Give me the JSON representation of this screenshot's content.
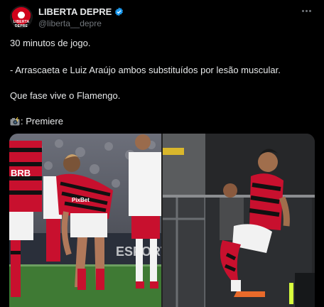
{
  "tweet": {
    "display_name": "LIBERTA DEPRE",
    "handle": "@liberta__depre",
    "avatar_text": "LIBERTA DEPRE",
    "lines": [
      "30 minutos de jogo.",
      "- Arrascaeta e Luiz Araújo ambos substituídos por lesão muscular.",
      "Que fase vive o Flamengo.",
      ": Premiere"
    ]
  },
  "media": {
    "left_shirt_text": "BRB",
    "left_sponsor": "PixBet",
    "board_text": "ESPORTES"
  },
  "colors": {
    "background": "#000000",
    "text_primary": "#e7e9ea",
    "text_secondary": "#71767b",
    "verified": "#1d9bf0",
    "flamengo_red": "#c8102e"
  }
}
